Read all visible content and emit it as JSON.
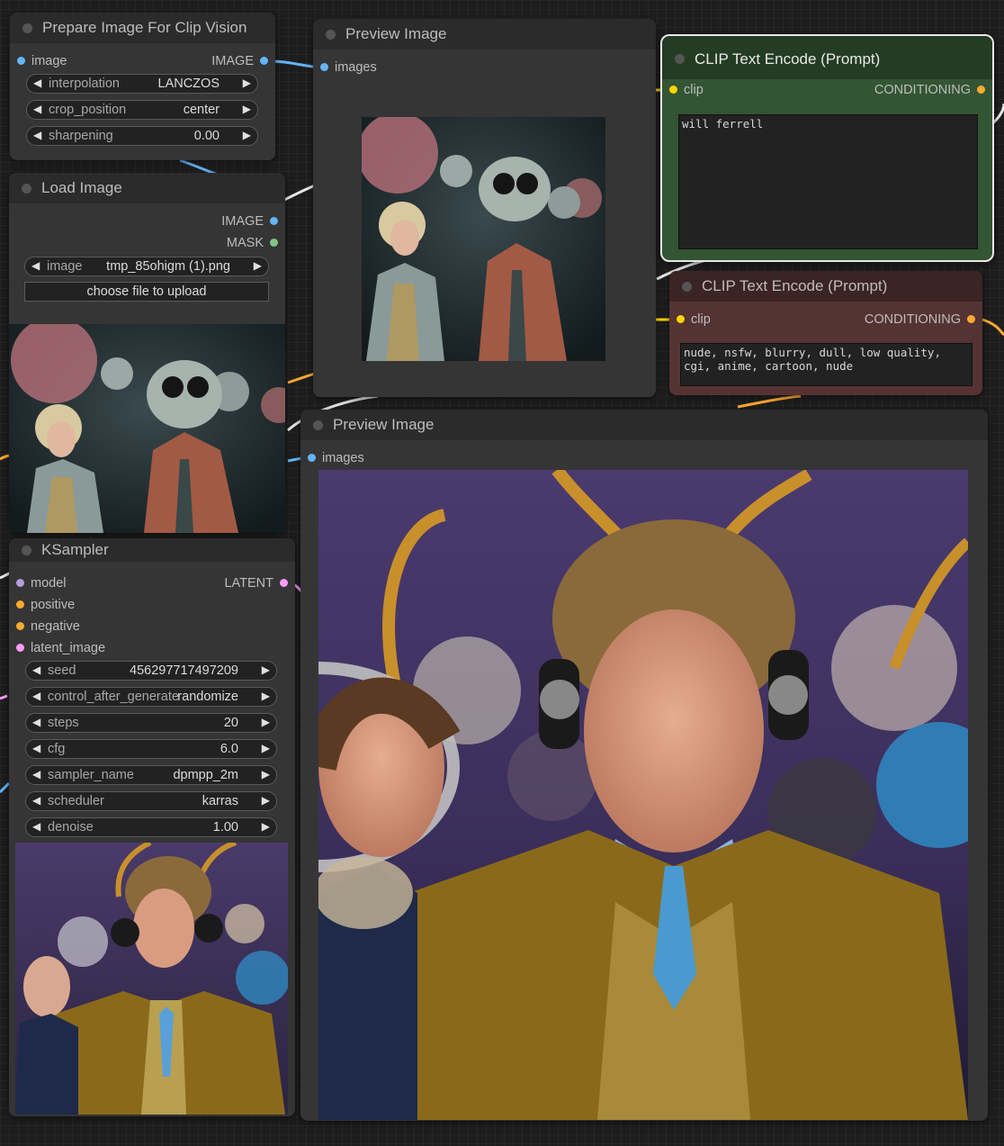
{
  "colors": {
    "image_port": "#64b5f6",
    "mask_port": "#81c784",
    "model_port": "#b39ddb",
    "conditioning_port": "#ffa931",
    "clip_port": "#ffd500",
    "latent_port": "#ff9cf9",
    "positive_node": "#2e4a2e",
    "negative_node": "#4a2a2a"
  },
  "prep": {
    "title": "Prepare Image For Clip Vision",
    "in_image": "image",
    "out_image": "IMAGE",
    "widgets": [
      {
        "label": "interpolation",
        "value": "LANCZOS"
      },
      {
        "label": "crop_position",
        "value": "center"
      },
      {
        "label": "sharpening",
        "value": "0.00"
      }
    ]
  },
  "load": {
    "title": "Load Image",
    "out_image": "IMAGE",
    "out_mask": "MASK",
    "image_label": "image",
    "image_value": "tmp_85ohigm (1).png",
    "upload_label": "choose file to upload"
  },
  "preview1": {
    "title": "Preview Image",
    "in_images": "images"
  },
  "clip_pos": {
    "title": "CLIP Text Encode (Prompt)",
    "in_clip": "clip",
    "out_conditioning": "CONDITIONING",
    "text": "will ferrell"
  },
  "clip_neg": {
    "title": "CLIP Text Encode (Prompt)",
    "in_clip": "clip",
    "out_conditioning": "CONDITIONING",
    "text": "nude, nsfw, blurry, dull, low quality, cgi, anime, cartoon, nude"
  },
  "ksampler": {
    "title": "KSampler",
    "inputs": [
      "model",
      "positive",
      "negative",
      "latent_image"
    ],
    "out_latent": "LATENT",
    "widgets": [
      {
        "label": "seed",
        "value": "456297717497209"
      },
      {
        "label": "control_after_generate",
        "value": "randomize"
      },
      {
        "label": "steps",
        "value": "20"
      },
      {
        "label": "cfg",
        "value": "6.0"
      },
      {
        "label": "sampler_name",
        "value": "dpmpp_2m"
      },
      {
        "label": "scheduler",
        "value": "karras"
      },
      {
        "label": "denoise",
        "value": "1.00"
      }
    ]
  },
  "preview2": {
    "title": "Preview Image",
    "in_images": "images"
  }
}
